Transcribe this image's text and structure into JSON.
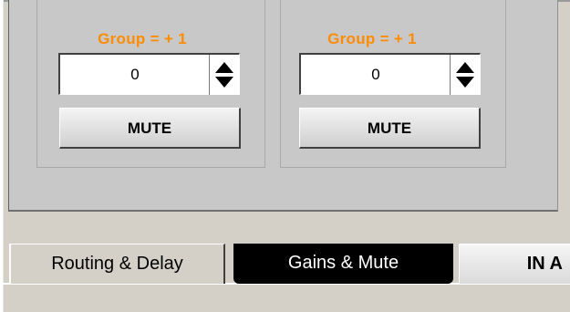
{
  "channels": [
    {
      "group_label": "Group = + 1",
      "value": "0",
      "mute_label": "MUTE"
    },
    {
      "group_label": "Group = + 1",
      "value": "0",
      "mute_label": "MUTE"
    }
  ],
  "tabs": [
    {
      "label": "Routing & Delay",
      "active": false
    },
    {
      "label": "Gains & Mute",
      "active": true
    },
    {
      "label": "IN A",
      "active": false
    }
  ],
  "colors": {
    "group_label": "#ff8c00",
    "active_tab_bg": "#000000",
    "panel_bg": "#c8c8c8"
  }
}
